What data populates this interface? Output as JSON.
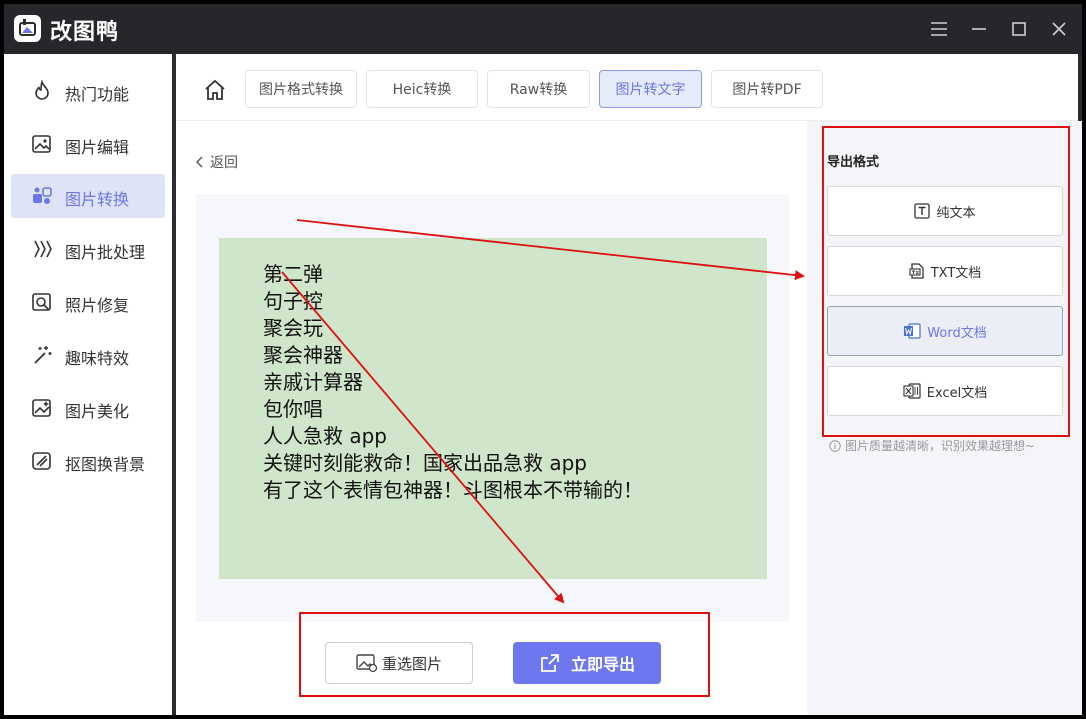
{
  "app": {
    "title": "改图鸭"
  },
  "sidebar": {
    "items": [
      {
        "label": "热门功能",
        "icon": "flame-icon"
      },
      {
        "label": "图片编辑",
        "icon": "image-edit-icon"
      },
      {
        "label": "图片转换",
        "icon": "convert-icon"
      },
      {
        "label": "图片批处理",
        "icon": "batch-icon"
      },
      {
        "label": "照片修复",
        "icon": "photo-repair-icon"
      },
      {
        "label": "趣味特效",
        "icon": "magic-wand-icon"
      },
      {
        "label": "图片美化",
        "icon": "beautify-icon"
      },
      {
        "label": "抠图换背景",
        "icon": "cutout-icon"
      }
    ],
    "active_index": 2
  },
  "tabs": [
    {
      "label": "图片格式转换"
    },
    {
      "label": "Heic转换"
    },
    {
      "label": "Raw转换"
    },
    {
      "label": "图片转文字"
    },
    {
      "label": "图片转PDF"
    }
  ],
  "active_tab": 3,
  "main": {
    "back_label": "返回",
    "ocr_lines": [
      "第二弹",
      "句子控",
      "聚会玩",
      "聚会神器",
      "亲戚计算器",
      "包你唱",
      "人人急救 app",
      "关键时刻能救命！国家出品急救 app",
      "有了这个表情包神器！斗图根本不带输的！"
    ],
    "reselect_label": "重选图片",
    "export_label": "立即导出"
  },
  "export_panel": {
    "title": "导出格式",
    "formats": [
      {
        "label": "纯文本",
        "icon": "text-icon"
      },
      {
        "label": "TXT文档",
        "icon": "txt-file-icon"
      },
      {
        "label": "Word文档",
        "icon": "word-icon"
      },
      {
        "label": "Excel文档",
        "icon": "excel-icon"
      }
    ],
    "selected_index": 2,
    "hint": "图片质量越清晰，识别效果越理想~"
  },
  "colors": {
    "accent": "#6e78ee",
    "annotation_red": "#dd1111",
    "preview_bg": "#d0e6ca",
    "titlebar": "#25272b"
  }
}
